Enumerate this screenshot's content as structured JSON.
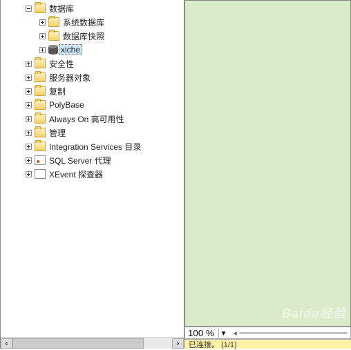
{
  "tree": {
    "databases": {
      "label": "数据库",
      "expanded": true
    },
    "sys_db": {
      "label": "系统数据库"
    },
    "db_snapshots": {
      "label": "数据库快照"
    },
    "xiche": {
      "label": "xiche"
    },
    "security": {
      "label": "安全性"
    },
    "server_objects": {
      "label": "服务器对象"
    },
    "replication": {
      "label": "复制"
    },
    "polybase": {
      "label": "PolyBase"
    },
    "alwayson": {
      "label": "Always On 高可用性"
    },
    "management": {
      "label": "管理"
    },
    "integration": {
      "label": "Integration Services 目录"
    },
    "sqlagent": {
      "label": "SQL Server 代理"
    },
    "xevent": {
      "label": "XEvent 探查器"
    }
  },
  "zoom": {
    "value": "100 %"
  },
  "status": {
    "text": "已连接。 (1/1)"
  },
  "watermark": {
    "text": "Baidu经验"
  }
}
